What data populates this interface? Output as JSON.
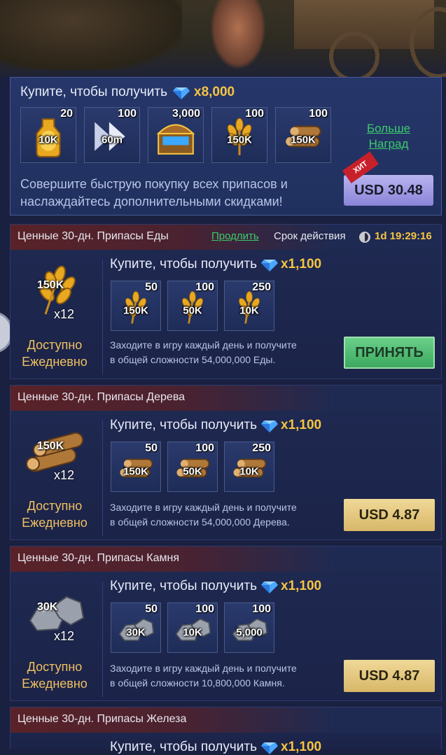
{
  "top_offer": {
    "title": "Купите, чтобы получить",
    "gems": "x8,000",
    "items": [
      {
        "count": "20",
        "amount": "10K",
        "icon": "food-bottle-icon"
      },
      {
        "count": "100",
        "amount": "60m",
        "icon": "speedup-icon"
      },
      {
        "count": "3,000",
        "amount": "",
        "icon": "gem-chest-icon"
      },
      {
        "count": "100",
        "amount": "150K",
        "icon": "wheat-icon"
      },
      {
        "count": "100",
        "amount": "150K",
        "icon": "wood-icon"
      }
    ],
    "more_rewards": "Больше Наград",
    "description_line1": "Совершите быструю покупку всех припасов и",
    "description_line2": "наслаждайтесь дополнительными скидками!",
    "badge": "ХИТ",
    "price": "USD 30.48"
  },
  "cards": [
    {
      "name": "Ценные 30-дн. Припасы Еды",
      "renew": "Продлить",
      "term_label": "Срок действия",
      "timer": "1d 19:29:16",
      "big_amount": "150K",
      "multiplier": "x12",
      "avail1": "Доступно",
      "avail2": "Ежедневно",
      "title": "Купите, чтобы получить",
      "gems": "x1,100",
      "items": [
        {
          "count": "50",
          "amount": "150K"
        },
        {
          "count": "100",
          "amount": "50K"
        },
        {
          "count": "250",
          "amount": "10K"
        }
      ],
      "desc1": "Заходите в игру каждый день и получите",
      "desc2": "в общей сложности 54,000,000 Еды.",
      "button": "ПРИНЯТЬ"
    },
    {
      "name": "Ценные 30-дн. Припасы Дерева",
      "big_amount": "150K",
      "multiplier": "x12",
      "avail1": "Доступно",
      "avail2": "Ежедневно",
      "title": "Купите, чтобы получить",
      "gems": "x1,100",
      "items": [
        {
          "count": "50",
          "amount": "150K"
        },
        {
          "count": "100",
          "amount": "50K"
        },
        {
          "count": "250",
          "amount": "10K"
        }
      ],
      "desc1": "Заходите в игру каждый день и получите",
      "desc2": "в общей сложности 54,000,000 Дерева.",
      "button": "USD 4.87"
    },
    {
      "name": "Ценные 30-дн. Припасы Камня",
      "big_amount": "30K",
      "multiplier": "x12",
      "avail1": "Доступно",
      "avail2": "Ежедневно",
      "title": "Купите, чтобы получить",
      "gems": "x1,100",
      "items": [
        {
          "count": "50",
          "amount": "30K"
        },
        {
          "count": "100",
          "amount": "10K"
        },
        {
          "count": "100",
          "amount": "5,000"
        }
      ],
      "desc1": "Заходите в игру каждый день и получите",
      "desc2": "в общей сложности 10,800,000 Камня.",
      "button": "USD 4.87"
    },
    {
      "name": "Ценные 30-дн. Припасы Железа",
      "title": "Купите, чтобы получить",
      "gems": "x1,100"
    }
  ],
  "colors": {
    "gold": "#f5c542",
    "green": "#3ccb6a",
    "panel": "#1f2a52"
  }
}
